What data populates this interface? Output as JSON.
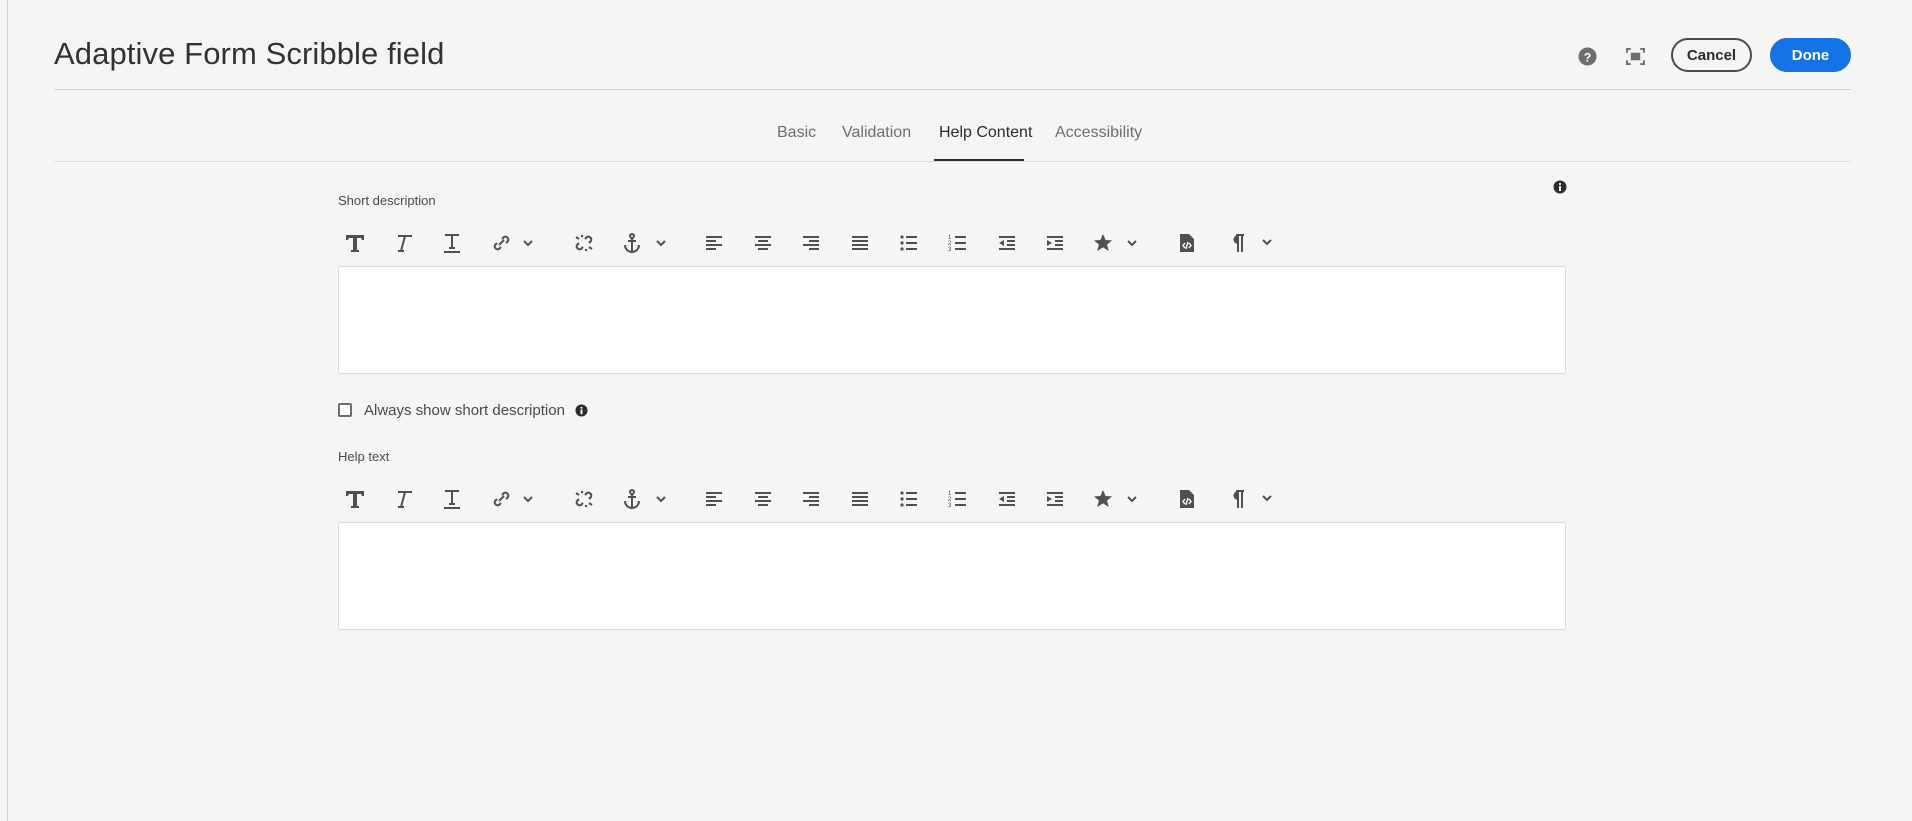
{
  "dialog": {
    "title": "Adaptive Form Scribble field",
    "help_icon": "question-circle-icon",
    "fullscreen_icon": "fullscreen-icon",
    "cancel_label": "Cancel",
    "done_label": "Done",
    "accent_color": "#1473e6"
  },
  "tabs": [
    {
      "label": "Basic"
    },
    {
      "label": "Validation"
    },
    {
      "label": "Help Content",
      "active": true
    },
    {
      "label": "Accessibility"
    }
  ],
  "short_description": {
    "label": "Short description",
    "value": ""
  },
  "always_show": {
    "label": "Always show short description",
    "checked": false
  },
  "help_text": {
    "label": "Help text",
    "value": ""
  },
  "toolbar_icons": [
    "bold-icon",
    "italic-icon",
    "underline-icon",
    "link-icon",
    "unlink-icon",
    "anchor-icon",
    "align-left-icon",
    "align-center-icon",
    "align-right-icon",
    "justify-icon",
    "bullet-list-icon",
    "numbered-list-icon",
    "outdent-icon",
    "indent-icon",
    "special-characters-icon",
    "source-edit-icon",
    "paragraph-format-icon"
  ]
}
